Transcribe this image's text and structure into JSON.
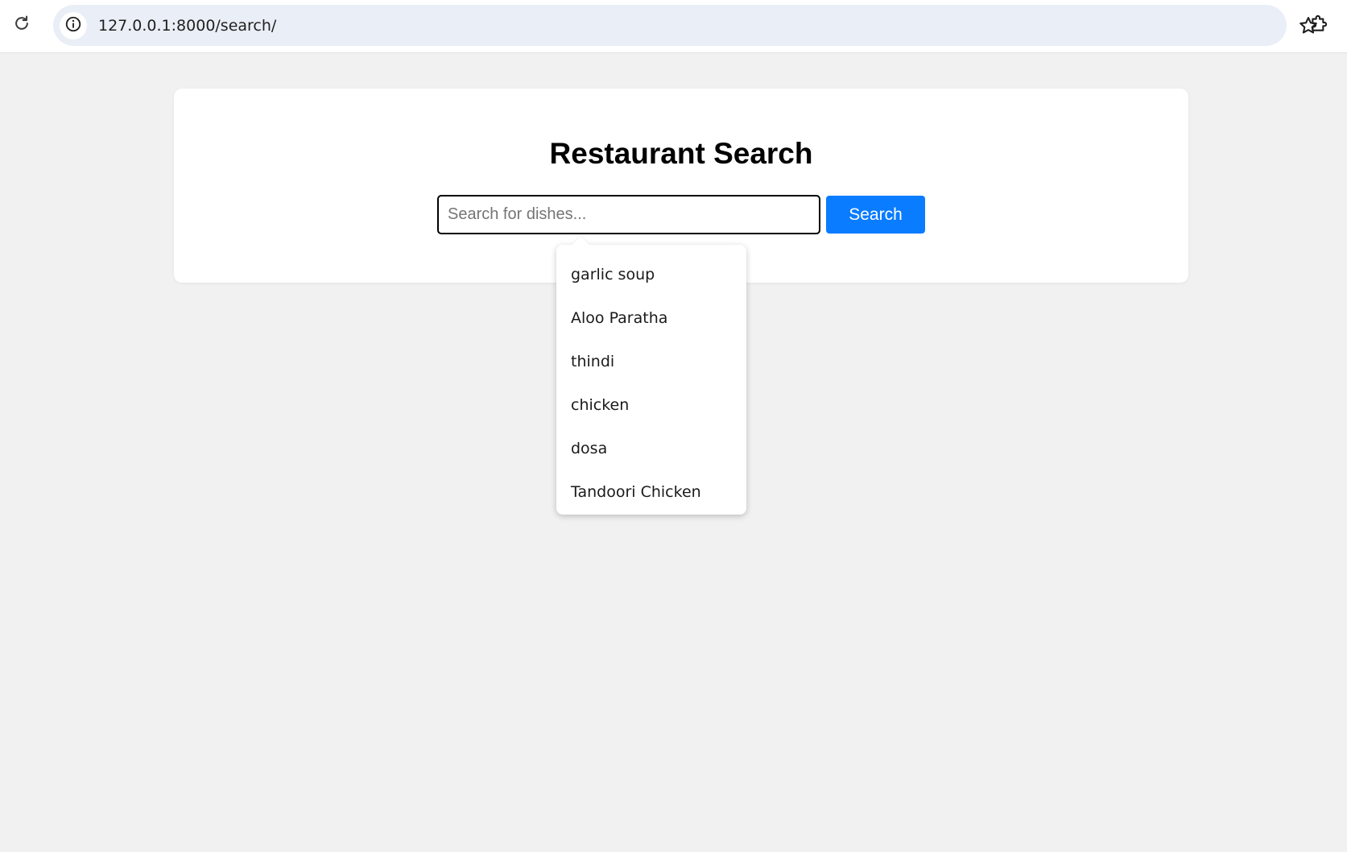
{
  "browser": {
    "url": "127.0.0.1:8000/search/",
    "icons": {
      "reload": "reload-icon",
      "site_info": "info-icon",
      "bookmark": "star-icon",
      "extensions": "puzzle-icon"
    }
  },
  "page": {
    "title": "Restaurant Search",
    "search": {
      "value": "",
      "placeholder": "Search for dishes..."
    },
    "search_button_label": "Search",
    "suggestions": [
      "garlic soup",
      "Aloo Paratha",
      "thindi",
      "chicken",
      "dosa",
      "Tandoori Chicken"
    ]
  },
  "colors": {
    "page_background": "#f1f1f1",
    "card_background": "#ffffff",
    "accent_button": "#0a7cff",
    "omnibox_background": "#eaeef6"
  }
}
